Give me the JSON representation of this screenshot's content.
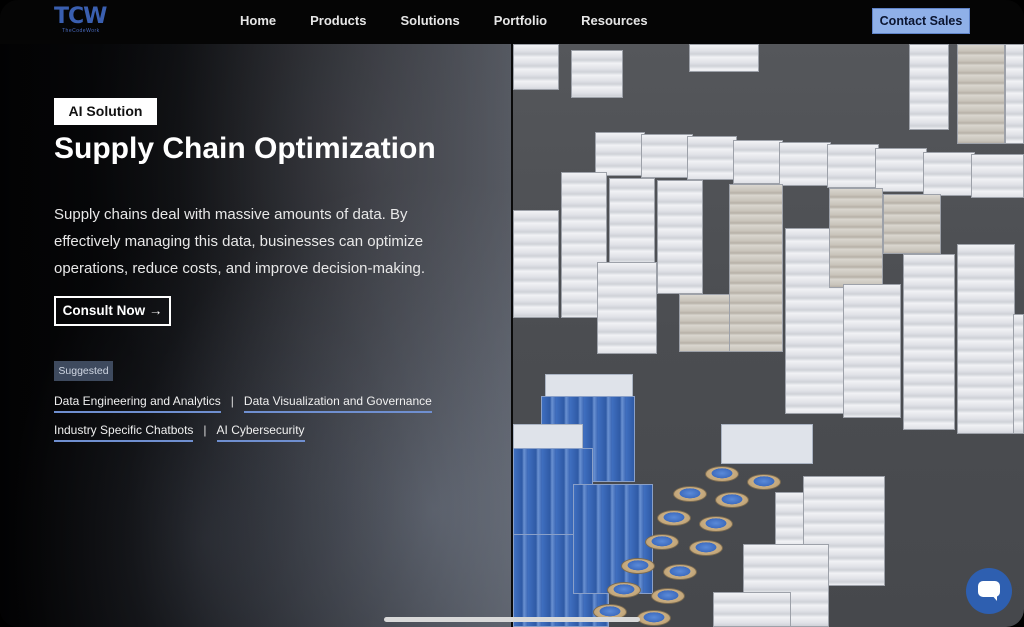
{
  "brand": {
    "logo_text": "TCW",
    "logo_subtext": "TheCodeWork"
  },
  "nav": {
    "items": [
      "Home",
      "Products",
      "Solutions",
      "Portfolio",
      "Resources"
    ],
    "contact_label": "Contact Sales"
  },
  "hero": {
    "badge": "AI Solution",
    "title": "Supply Chain Optimization",
    "description": "Supply chains deal with massive amounts of data. By effectively managing this data, businesses can optimize operations, reduce costs, and improve decision-making.",
    "cta_label": "Consult Now →"
  },
  "suggested": {
    "label": "Suggested",
    "links": [
      "Data Engineering and Analytics",
      "Data Visualization and Governance",
      "Industry Specific Chatbots",
      "AI Cybersecurity"
    ],
    "separator": "|"
  },
  "colors": {
    "accent": "#8fb0e8",
    "link_underline": "#6f8fd0",
    "chat_button": "#2e5fb0",
    "badge_bg": "#3e4a5e"
  },
  "icons": {
    "chat": "chat-bubble-icon",
    "arrow": "arrow-right-icon"
  }
}
